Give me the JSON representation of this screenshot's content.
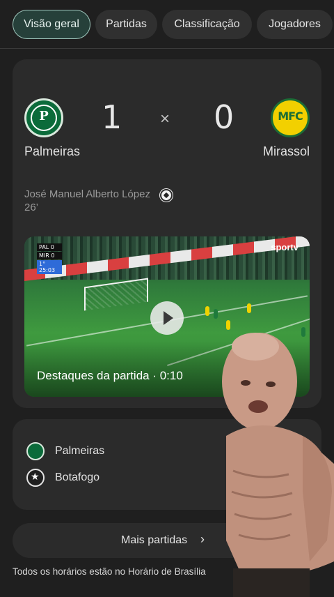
{
  "tabs": [
    {
      "label": "Visão geral",
      "active": true
    },
    {
      "label": "Partidas",
      "active": false
    },
    {
      "label": "Classificação",
      "active": false
    },
    {
      "label": "Jogadores",
      "active": false
    }
  ],
  "match": {
    "home": {
      "name": "Palmeiras",
      "score": "1",
      "logo_text": "P"
    },
    "away": {
      "name": "Mirassol",
      "score": "0",
      "logo_text": "MFC"
    },
    "separator": "×",
    "scorer": "José Manuel Alberto López 26’",
    "scorer_icon": "soccer-ball-icon"
  },
  "video": {
    "caption": "Destaques da partida · 0:10",
    "scorebug": [
      "PAL 0",
      "MIR 0",
      "1° 25:03"
    ],
    "broadcaster": "sportv"
  },
  "teams_list": [
    {
      "name": "Palmeiras",
      "icon": "palmeiras-crest-icon"
    },
    {
      "name": "Botafogo",
      "icon": "botafogo-crest-icon"
    }
  ],
  "more_button": {
    "label": "Mais partidas",
    "icon": "chevron-right-icon"
  },
  "footnote": "Todos os horários estão no Horário de Brasília",
  "colors": {
    "background": "#1f1f1f",
    "card": "#2b2b2b",
    "active_tab_bg": "#26403a",
    "active_tab_border": "#9fc7bd",
    "palmeiras_green": "#0b6b3a",
    "mirassol_yellow": "#f2d000"
  }
}
